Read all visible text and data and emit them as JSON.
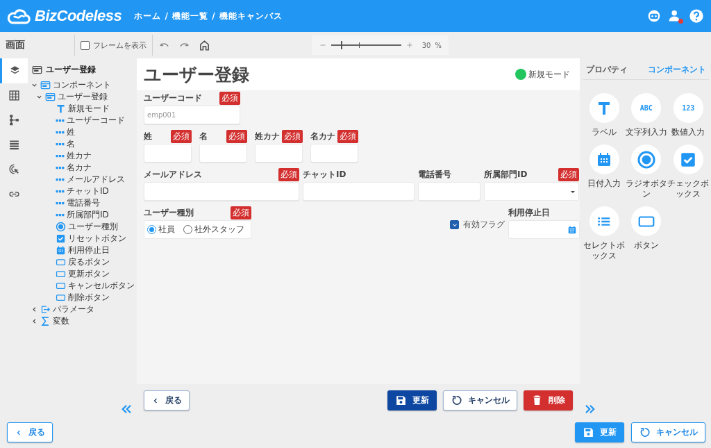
{
  "header": {
    "brand": "BizCodeless",
    "breadcrumb": "ホーム / 機能一覧 / 機能キャンバス"
  },
  "toolbar": {
    "title": "画面",
    "frame_toggle": {
      "label": "フレームを表示",
      "checked": false
    },
    "zoom": {
      "level": 0.14,
      "value": "30",
      "unit": "%"
    }
  },
  "rail": [
    {
      "kind": "layers",
      "selected": true
    },
    {
      "kind": "grid",
      "selected": false
    },
    {
      "kind": "hierarchy",
      "selected": false
    },
    {
      "kind": "list",
      "selected": false
    },
    {
      "kind": "cursor",
      "selected": false
    },
    {
      "kind": "link",
      "selected": false
    }
  ],
  "tree": {
    "title": "ユーザー登録",
    "items": [
      {
        "kind": "form",
        "label": "コンポーネント",
        "expanded": true,
        "children": [
          {
            "kind": "form",
            "label": "ユーザー登録",
            "expanded": true,
            "children": [
              {
                "kind": "label",
                "label": "新規モード"
              },
              {
                "kind": "text",
                "label": "ユーザーコード"
              },
              {
                "kind": "text",
                "label": "姓"
              },
              {
                "kind": "text",
                "label": "名"
              },
              {
                "kind": "text",
                "label": "姓カナ"
              },
              {
                "kind": "text",
                "label": "名カナ"
              },
              {
                "kind": "text",
                "label": "メールアドレス"
              },
              {
                "kind": "text",
                "label": "チャットID"
              },
              {
                "kind": "text",
                "label": "電話番号"
              },
              {
                "kind": "text",
                "label": "所属部門ID"
              },
              {
                "kind": "radio",
                "label": "ユーザー種別"
              },
              {
                "kind": "checkbox",
                "label": "リセットボタン"
              },
              {
                "kind": "date",
                "label": "利用停止日"
              },
              {
                "kind": "button",
                "label": "戻るボタン"
              },
              {
                "kind": "button",
                "label": "更新ボタン"
              },
              {
                "kind": "button",
                "label": "キャンセルボタン"
              },
              {
                "kind": "button",
                "label": "削除ボタン"
              }
            ]
          }
        ]
      },
      {
        "kind": "param",
        "label": "パラメータ",
        "expanded": false
      },
      {
        "kind": "sum",
        "label": "変数",
        "expanded": false
      }
    ]
  },
  "canvas": {
    "title": "ユーザー登録",
    "mode": {
      "label": "新規モード",
      "color": "#22c55e"
    },
    "groups": [
      {
        "fields": [
          {
            "kind": "text",
            "label": "ユーザーコード",
            "required": "必須",
            "placeholder": "emp001"
          }
        ]
      },
      {
        "fields": [
          {
            "kind": "text",
            "label": "姓",
            "required": "必須"
          },
          {
            "kind": "text",
            "label": "名",
            "required": "必須"
          },
          {
            "kind": "text",
            "label": "姓カナ",
            "required": "必須"
          },
          {
            "kind": "text",
            "label": "名カナ",
            "required": "必須"
          }
        ]
      },
      {
        "fields": [
          {
            "kind": "text",
            "label": "メールアドレス",
            "required": "必須"
          },
          {
            "kind": "text",
            "label": "チャットID"
          },
          {
            "kind": "text",
            "label": "電話番号"
          },
          {
            "kind": "select",
            "label": "所属部門ID",
            "required": "必須"
          }
        ]
      },
      {
        "fields": [
          {
            "kind": "radio",
            "label": "ユーザー種別",
            "required": "必須",
            "options": [
              {
                "label": "社員",
                "selected": true
              },
              {
                "label": "社外スタッフ",
                "selected": false
              }
            ]
          },
          {
            "kind": "checkbox",
            "label": "有効フラグ",
            "checked": true
          },
          {
            "kind": "date",
            "label": "利用停止日"
          }
        ]
      }
    ],
    "buttons": [
      {
        "kind": "back",
        "label": "戻る"
      },
      {
        "kind": "save",
        "label": "更新"
      },
      {
        "kind": "cancel",
        "label": "キャンセル"
      },
      {
        "kind": "delete",
        "label": "削除"
      }
    ]
  },
  "panel": {
    "tabs": [
      {
        "label": "プロパティ",
        "selected": false
      },
      {
        "label": "コンポーネント",
        "selected": true
      }
    ],
    "palette": [
      {
        "kind": "label",
        "label": "ラベル"
      },
      {
        "kind": "text",
        "label": "文字列入力",
        "glyph": "ABC"
      },
      {
        "kind": "number",
        "label": "数値入力",
        "glyph": "123"
      },
      {
        "kind": "date",
        "label": "日付入力"
      },
      {
        "kind": "radio",
        "label": "ラジオボタン"
      },
      {
        "kind": "checkbox",
        "label": "チェックボックス"
      },
      {
        "kind": "select",
        "label": "セレクトボックス"
      },
      {
        "kind": "button",
        "label": "ボタン"
      }
    ]
  },
  "footer": {
    "buttons": [
      {
        "kind": "back",
        "label": "戻る"
      },
      {
        "kind": "save",
        "label": "更新"
      },
      {
        "kind": "cancel",
        "label": "キャンセル"
      }
    ]
  }
}
